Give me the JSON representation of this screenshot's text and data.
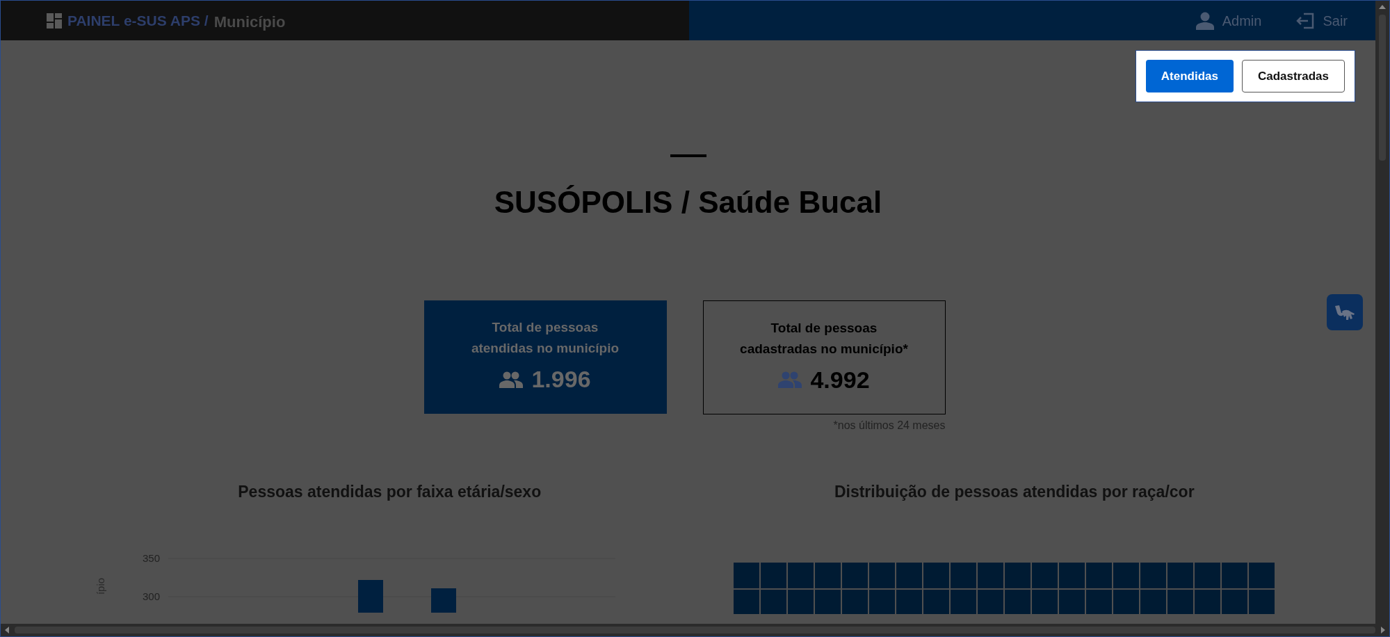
{
  "header": {
    "app_name": "PAINEL e-SUS APS /",
    "section": "Município",
    "user": "Admin",
    "logout": "Sair"
  },
  "view_toggle": [
    {
      "label": "Atendidas",
      "selected": true
    },
    {
      "label": "Cadastradas",
      "selected": false
    }
  ],
  "title": "SUSÓPOLIS / Saúde Bucal",
  "cards": [
    {
      "label_lines": [
        "Total de pessoas",
        "atendidas no município"
      ],
      "value": "1.996",
      "selected": true
    },
    {
      "label_lines": [
        "Total de pessoas",
        "cadastradas no município*"
      ],
      "value": "4.992",
      "selected": false
    }
  ],
  "footnote": "*nos últimos 24 meses",
  "charts": [
    {
      "title": "Pessoas atendidas por faixa etária/sexo",
      "axis": {
        "title": "ípio",
        "tick_labels": [
          "350",
          "300"
        ]
      }
    },
    {
      "title": "Distribuição de pessoas atendidas por raça/cor"
    }
  ]
}
